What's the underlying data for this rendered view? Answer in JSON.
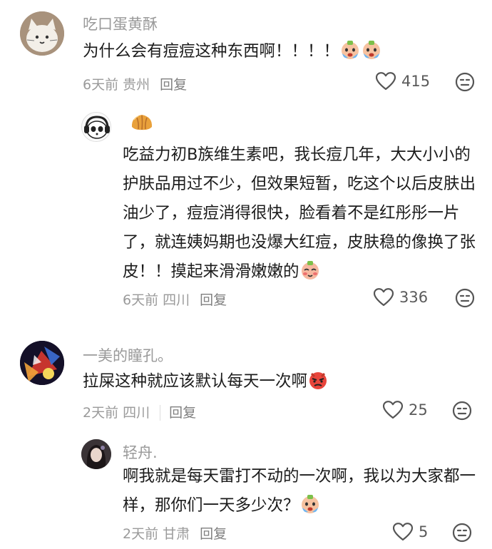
{
  "comments": [
    {
      "username": "吃口蛋黄酥",
      "text": "为什么会有痘痘这种东西啊！！！！",
      "time": "6天前",
      "location": "贵州",
      "reply_label": "回复",
      "likes": "415",
      "avatar": "cat-avatar",
      "trailing_emoji": [
        "crying-face-icon",
        "crying-face-icon"
      ]
    },
    {
      "username": "",
      "avatar": "panda-headphones-avatar",
      "sticker": "croissant-icon",
      "text": "吃益力初B族维生素吧，我长痘几年，大大小小的护肤品用过不少，但效果短暂，吃这个以后皮肤出油少了，痘痘消得很快，脸看着不是红彤彤一片了，就连姨妈期也没爆大红痘，皮肤稳的像换了张皮！！摸起来滑滑嫩嫩的",
      "time": "6天前",
      "location": "四川",
      "reply_label": "回复",
      "likes": "336",
      "trailing_emoji": [
        "blush-face-icon"
      ]
    },
    {
      "username": "一美的瞳孔。",
      "text": "拉屎这种就应该默认每天一次啊",
      "time": "2天前",
      "location": "四川",
      "reply_label": "回复",
      "likes": "25",
      "avatar": "colorful-avatar",
      "trailing_emoji": [
        "angry-face-icon"
      ]
    },
    {
      "username": "轻舟.",
      "text": "啊我就是每天雷打不动的一次啊，我以为大家都一样，那你们一天多少次？",
      "time": "2天前",
      "location": "甘肃",
      "reply_label": "回复",
      "likes": "5",
      "avatar": "girl-avatar",
      "trailing_emoji": [
        "crying-face-icon"
      ]
    }
  ],
  "colors": {
    "text": "#1b1b1b",
    "meta": "#9a9a9a",
    "icon": "#555555"
  }
}
